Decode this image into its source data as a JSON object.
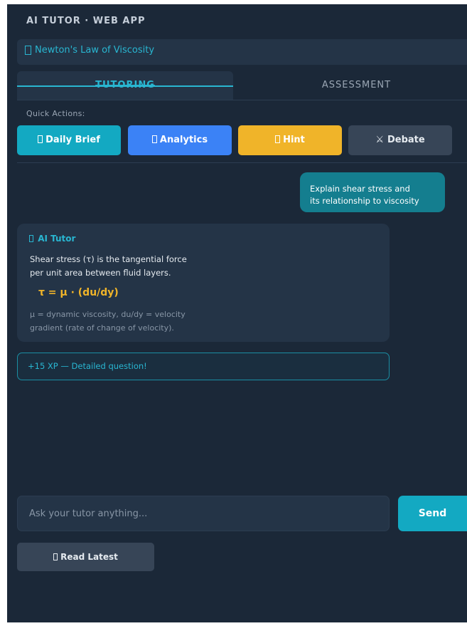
{
  "app": {
    "title": "AI TUTOR · WEB APP"
  },
  "topic": {
    "icon": "book-icon",
    "label": "Newton's Law of Viscosity"
  },
  "tabs": [
    {
      "label": "TUTORING",
      "active": true
    },
    {
      "label": "ASSESSMENT",
      "active": false
    }
  ],
  "quick_actions": {
    "label": "Quick Actions:",
    "buttons": [
      {
        "label": "Daily Brief",
        "icon": "newspaper-icon",
        "color": "#13a9c2"
      },
      {
        "label": "Analytics",
        "icon": "chart-icon",
        "color": "#3b82f6"
      },
      {
        "label": "Hint",
        "icon": "lightbulb-icon",
        "color": "#f0b429"
      },
      {
        "label": "Debate",
        "icon": "swords-icon",
        "icon_glyph": "⚔",
        "color": "#374557"
      }
    ]
  },
  "chat": {
    "user_message": {
      "line1": "Explain shear stress and",
      "line2": "its relationship to viscosity"
    },
    "ai_message": {
      "sender": "AI Tutor",
      "line1": "Shear stress (τ) is the tangential force",
      "line2": "per unit area between fluid layers.",
      "formula": "τ = μ · (du/dy)",
      "note_line1": "μ = dynamic viscosity, du/dy = velocity",
      "note_line2": "gradient (rate of change of velocity)."
    },
    "xp_badge": "+15 XP — Detailed question!"
  },
  "composer": {
    "placeholder": "Ask your tutor anything...",
    "value": "",
    "send_label": "Send"
  },
  "read_latest": {
    "label": "Read Latest",
    "icon": "speaker-icon"
  },
  "colors": {
    "background": "#1b2838",
    "panel": "#243447",
    "accent": "#29b6d1",
    "formula": "#f0b429"
  }
}
